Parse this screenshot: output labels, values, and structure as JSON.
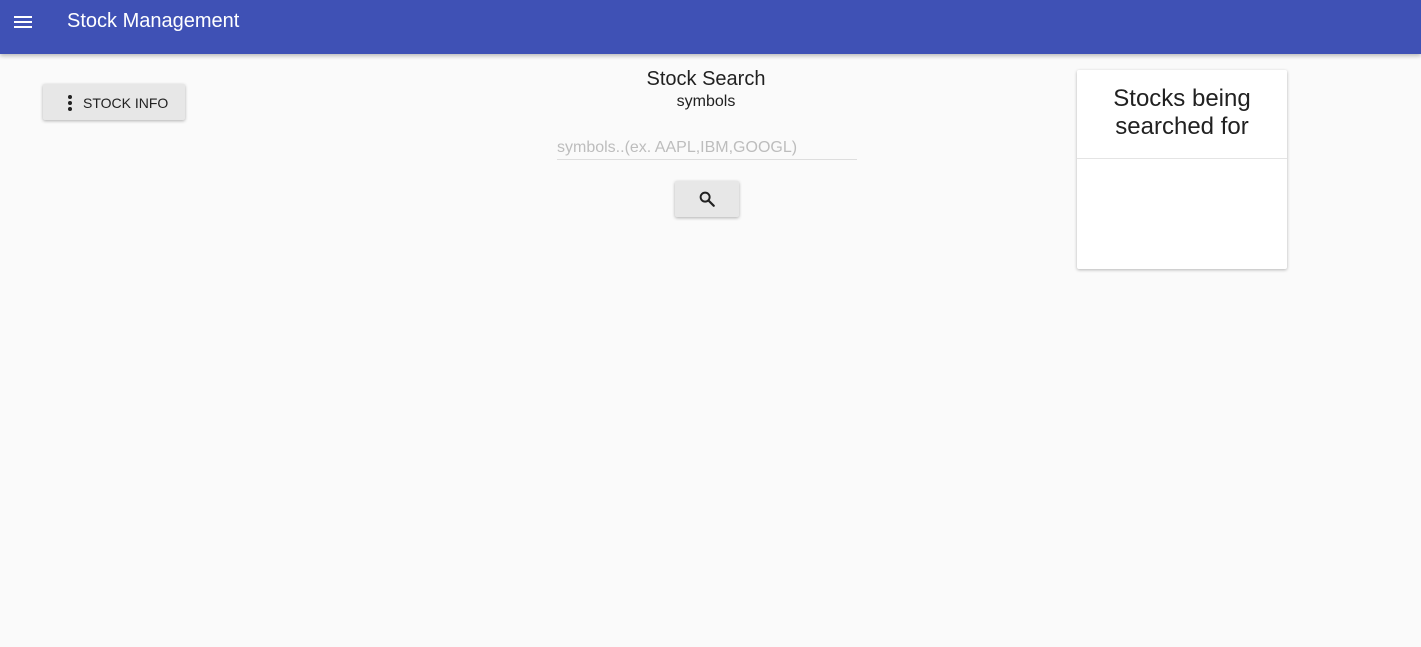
{
  "toolbar": {
    "title": "Stock Management",
    "color": "#3f51b5",
    "menu_icon": "hamburger-menu-icon"
  },
  "stock_info_button": {
    "label": "STOCK INFO",
    "icon": "more-vertical-icon"
  },
  "search": {
    "title": "Stock Search",
    "subtitle": "symbols",
    "input_value": "",
    "input_placeholder": "symbols..(ex. AAPL,IBM,GOOGL)",
    "button_icon": "search-icon"
  },
  "searched_card": {
    "title": "Stocks being searched for",
    "items": []
  }
}
